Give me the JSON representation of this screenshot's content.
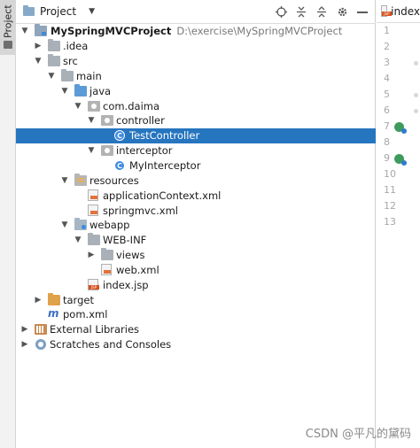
{
  "stripe": {
    "label": "Project"
  },
  "panel": {
    "view_title": "Project",
    "dropdown": "▼"
  },
  "tree": {
    "root": {
      "label": "MySpringMVCProject",
      "path": "D:\\exercise\\MySpringMVCProject"
    },
    "idea": ".idea",
    "src": "src",
    "main": "main",
    "java": "java",
    "package": "com.daima",
    "controller": "controller",
    "test_controller": "TestController",
    "interceptor": "interceptor",
    "my_interceptor": "MyInterceptor",
    "resources": "resources",
    "application_context": "applicationContext.xml",
    "springmvc": "springmvc.xml",
    "webapp": "webapp",
    "web_inf": "WEB-INF",
    "views": "views",
    "web_xml": "web.xml",
    "index_jsp": "index.jsp",
    "target": "target",
    "pom": "pom.xml",
    "external_libraries": "External Libraries",
    "scratches": "Scratches and Consoles",
    "class_glyph": "C"
  },
  "editor": {
    "tab_label": "index",
    "line_numbers": [
      "1",
      "2",
      "3",
      "4",
      "5",
      "6",
      "7",
      "8",
      "9",
      "10",
      "11",
      "12",
      "13"
    ]
  },
  "watermark": "CSDN @平凡的黛码",
  "icons": [
    "locate-icon",
    "expand-all-icon",
    "collapse-all-icon",
    "gear-icon",
    "hide-icon",
    "folder-icon",
    "module-icon",
    "package-icon",
    "class-icon",
    "xml-file-icon",
    "jsp-file-icon",
    "maven-icon",
    "libraries-icon",
    "scratches-icon",
    "run-gutter-icon"
  ],
  "colors": {
    "selection": "#2675bf",
    "source_folder": "#5d9bd6",
    "excluded_folder": "#e0a14b",
    "class_icon": "#3c8be0"
  }
}
